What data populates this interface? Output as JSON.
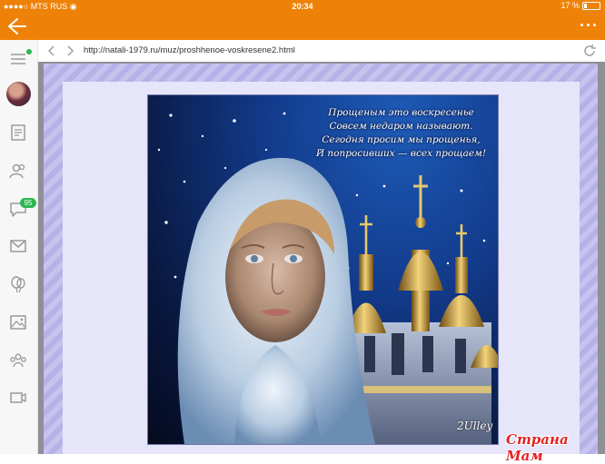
{
  "status_bar": {
    "carrier": "MTS RUS",
    "time": "20:34",
    "battery_percent": "17 %",
    "battery_level": 0.17
  },
  "app_bar": {
    "accent_color": "#ee8208"
  },
  "sidebar": {
    "notification_badge": "95",
    "online_dot_color": "#2cb550",
    "icons": [
      "menu-icon",
      "avatar",
      "notes-icon",
      "friends-icon",
      "messages-icon",
      "mail-icon",
      "gifts-icon",
      "photos-icon",
      "groups-icon",
      "video-icon"
    ]
  },
  "browser": {
    "url": "http://natali-1979.ru/muz/proshhenoe-voskresene2.html"
  },
  "postcard": {
    "poem": [
      "Прощеным это воскресенье",
      "Совсем недаром называют.",
      "Сегодня просим мы прощенья,",
      "И попросивших — всех прощаем!"
    ],
    "signature": "2Ulley"
  },
  "watermark": "Страна Мам"
}
